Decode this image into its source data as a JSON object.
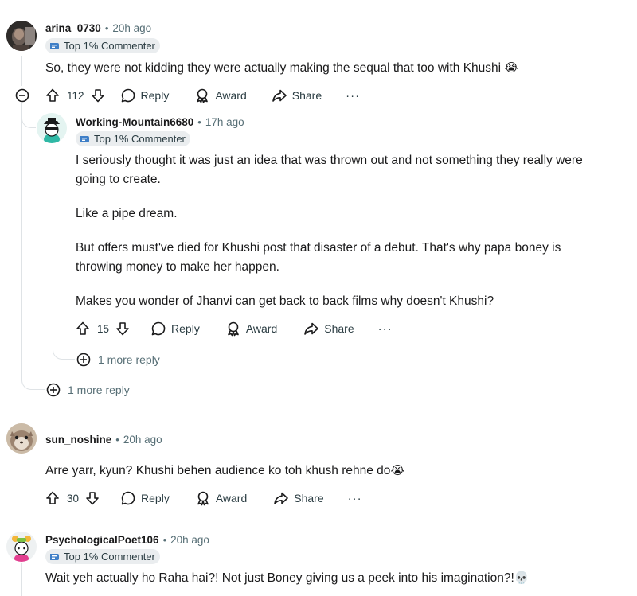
{
  "comments": [
    {
      "username": "arina_0730",
      "time": "20h ago",
      "badge": "Top 1% Commenter",
      "body": [
        "So, they were not kidding they were actually making the sequal that too with Khushi"
      ],
      "emoji": "😭",
      "votes": "112",
      "reply_label": "Reply",
      "award_label": "Award",
      "share_label": "Share",
      "more_replies": "1 more reply"
    },
    {
      "username": "Working-Mountain6680",
      "time": "17h ago",
      "badge": "Top 1% Commenter",
      "body": [
        "I seriously thought it was just an idea that was thrown out and not something they really were",
        "going to create.",
        "Like a pipe dream.",
        "But offers must've died for Khushi post that disaster of a debut. That's why papa boney is",
        "throwing money to make her happen.",
        "Makes you wonder of Jhanvi can get back to back films why doesn't Khushi?"
      ],
      "votes": "15",
      "reply_label": "Reply",
      "award_label": "Award",
      "share_label": "Share",
      "more_replies": "1 more reply"
    },
    {
      "username": "sun_noshine",
      "time": "20h ago",
      "body": [
        "Arre yarr, kyun? Khushi behen audience ko toh khush rehne do"
      ],
      "emoji": "😭",
      "votes": "30",
      "reply_label": "Reply",
      "award_label": "Award",
      "share_label": "Share"
    },
    {
      "username": "PsychologicalPoet106",
      "time": "20h ago",
      "badge": "Top 1% Commenter",
      "body": [
        "Wait yeh actually ho Raha hai?! Not just Boney giving us a peek into his imagination?!"
      ],
      "emoji": "💀"
    }
  ],
  "separator": "•",
  "more_menu": "···",
  "icons": {
    "upvote": "upvote-icon",
    "downvote": "downvote-icon",
    "reply": "speech-bubble-icon",
    "award": "award-icon",
    "share": "share-arrow-icon",
    "collapse": "collapse-minus-icon",
    "expand": "expand-plus-icon"
  }
}
